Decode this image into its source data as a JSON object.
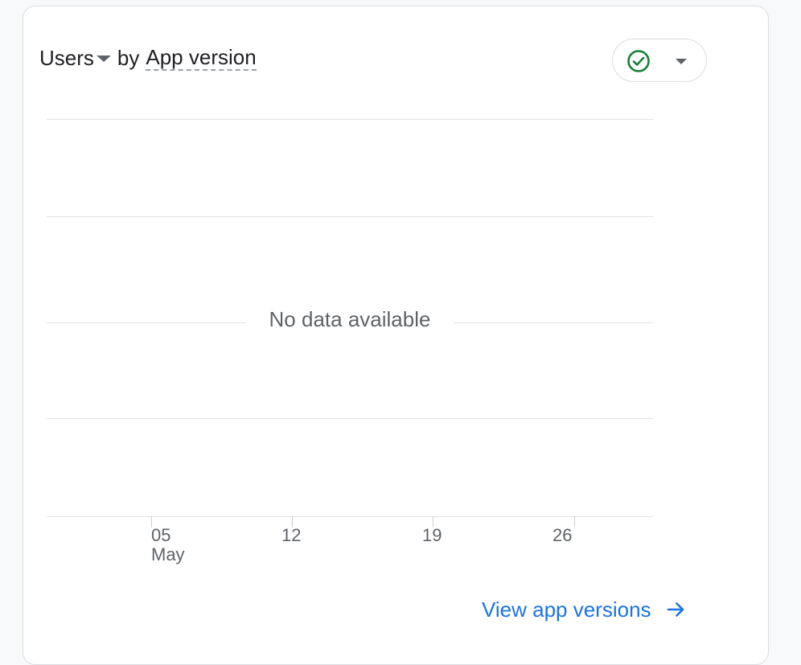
{
  "card": {
    "metric_label": "Users",
    "by_label": "by",
    "dimension_label": "App version",
    "status_icon": "check-circle-icon",
    "status_color": "#188038"
  },
  "chart_data": {
    "type": "line",
    "title": "",
    "x_tick_labels": [
      "05",
      "12",
      "19",
      "26"
    ],
    "x_tick_sublabels": [
      "May",
      "",
      "",
      ""
    ],
    "series": [],
    "empty_message": "No data available",
    "grid": true
  },
  "footer": {
    "link_label": "View app versions",
    "link_color": "#1a73e8",
    "arrow_icon": "arrow-right-icon"
  }
}
